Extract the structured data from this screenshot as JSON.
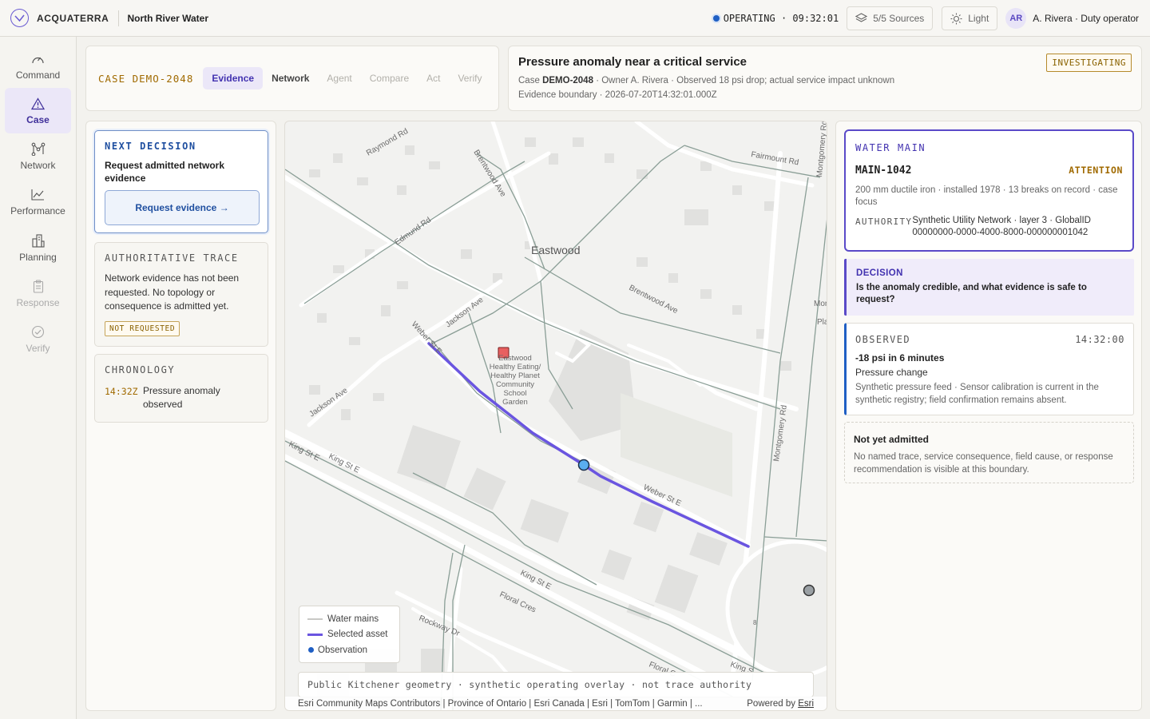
{
  "app": {
    "brand": "ACQUATERRA",
    "org": "North River Water",
    "status": "OPERATING · 09:32:01",
    "sources": "5/5 Sources",
    "theme": "Light",
    "user_initials": "AR",
    "user": "A. Rivera · Duty operator"
  },
  "nav": [
    {
      "label": "Command",
      "icon": "gauge-icon"
    },
    {
      "label": "Case",
      "icon": "warning-triangle-icon"
    },
    {
      "label": "Network",
      "icon": "network-icon"
    },
    {
      "label": "Performance",
      "icon": "line-chart-icon"
    },
    {
      "label": "Planning",
      "icon": "buildings-icon"
    },
    {
      "label": "Response",
      "icon": "clipboard-icon"
    },
    {
      "label": "Verify",
      "icon": "check-circle-icon"
    }
  ],
  "case": {
    "id": "CASE DEMO-2048",
    "tabs": [
      "Evidence",
      "Network",
      "Agent",
      "Compare",
      "Act",
      "Verify"
    ],
    "active_tab": "Evidence",
    "title": "Pressure anomaly near a critical service",
    "meta_prefix": "Case",
    "meta_id": "DEMO-2048",
    "meta_rest": "· Owner A. Rivera · Observed 18 psi drop; actual service impact unknown",
    "boundary": "Evidence boundary · 2026-07-20T14:32:01.000Z",
    "state": "INVESTIGATING"
  },
  "left": {
    "next_label": "NEXT DECISION",
    "next_text": "Request admitted network evidence",
    "next_button": "Request evidence →",
    "trace_label": "AUTHORITATIVE TRACE",
    "trace_text": "Network evidence has not been requested. No topology or consequence is admitted yet.",
    "trace_badge": "NOT REQUESTED",
    "chrono_label": "CHRONOLOGY",
    "chrono": [
      {
        "time": "14:32Z",
        "text": "Pressure anomaly observed"
      }
    ]
  },
  "map": {
    "place": "Eastwood",
    "poi": [
      "Eastwood",
      "Healthy Eating/",
      "Healthy Planet",
      "Community",
      "School",
      "Garden"
    ],
    "streets": [
      "Raymond Rd",
      "Brentwood Ave",
      "Fairmount Rd",
      "Montgomery Rd",
      "Edmund Rd",
      "Jackson Ave",
      "Weber St E",
      "Brentwood Ave",
      "Montgomery Rd",
      "Jackson Ave",
      "King St E",
      "King St E",
      "Weber St E",
      "King St E",
      "Floral Cres",
      "Rockway Dr",
      "Floral C",
      "King S",
      "Mon",
      "Pla",
      "8"
    ],
    "legend": [
      {
        "label": "Water mains",
        "color": "#c9c9c6"
      },
      {
        "label": "Selected asset",
        "color": "#6a55e0"
      },
      {
        "label": "Observation",
        "color": "#1f5fc4"
      }
    ],
    "caption": "Public Kitchener geometry · synthetic operating overlay · not trace authority",
    "attribution": "Esri Community Maps Contributors | Province of Ontario | Esri Canada | Esri | TomTom | Garmin | ...",
    "powered_prefix": "Powered by",
    "powered_link": "Esri"
  },
  "asset": {
    "kind": "WATER MAIN",
    "id": "MAIN-1042",
    "flag": "ATTENTION",
    "desc": "200 mm ductile iron · installed 1978 · 13 breaks on record · case focus",
    "auth_label": "AUTHORITY",
    "auth_value": "Synthetic Utility Network · layer 3 · GlobalID 00000000-0000-4000-8000-000000001042"
  },
  "decision": {
    "label": "DECISION",
    "question": "Is the anomaly credible, and what evidence is safe to request?"
  },
  "observed": {
    "label": "OBSERVED",
    "time": "14:32:00",
    "value": "-18 psi in 6 minutes",
    "type": "Pressure change",
    "desc": "Synthetic pressure feed · Sensor calibration is current in the synthetic registry; field confirmation remains absent."
  },
  "not_admitted": {
    "title": "Not yet admitted",
    "desc": "No named trace, service consequence, field cause, or response recommendation is visible at this boundary."
  }
}
